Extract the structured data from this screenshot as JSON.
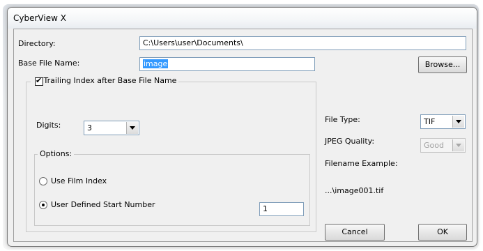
{
  "window": {
    "title": "CyberView X"
  },
  "directory": {
    "label": "Directory:",
    "value": "C:\\Users\\user\\Documents\\"
  },
  "base_file_name": {
    "label": "Base File Name:",
    "value": "image"
  },
  "browse_button": {
    "label": "Browse..."
  },
  "trailing_index": {
    "label": "Trailing Index after Base File Name",
    "checked": true
  },
  "digits": {
    "label": "Digits:",
    "value": "3"
  },
  "options": {
    "label": "Options:",
    "use_film_index": {
      "label": "Use Film Index",
      "selected": false
    },
    "user_defined_start": {
      "label": "User Defined Start Number",
      "selected": true,
      "value": "1"
    }
  },
  "file_type": {
    "label": "File Type:",
    "value": "TIF"
  },
  "jpeg_quality": {
    "label": "JPEG Quality:",
    "value": "Good",
    "disabled": true
  },
  "filename_example": {
    "label": "Filename Example:",
    "value": "...\\image001.tif"
  },
  "cancel_button": {
    "label": "Cancel"
  },
  "ok_button": {
    "label": "OK"
  }
}
